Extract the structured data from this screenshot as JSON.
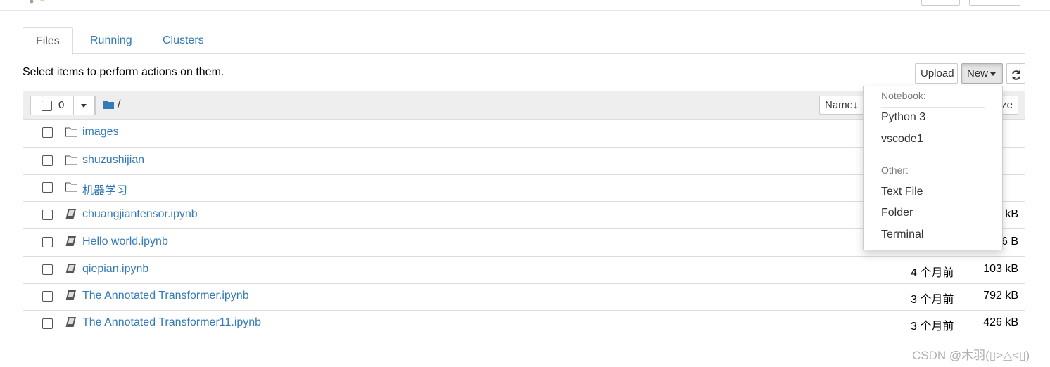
{
  "tabs": [
    {
      "label": "Files"
    },
    {
      "label": "Running"
    },
    {
      "label": "Clusters"
    }
  ],
  "hint": "Select items to perform actions on them.",
  "toolbar": {
    "upload_label": "Upload",
    "new_label": "New"
  },
  "list_header": {
    "selected_count": "0",
    "path": "/",
    "sort_name_label": "Name",
    "size_label": "ze"
  },
  "files": [
    {
      "name": "images",
      "type": "folder",
      "modified": "",
      "size": ""
    },
    {
      "name": "shuzushijian",
      "type": "folder",
      "modified": "",
      "size": ""
    },
    {
      "name": "机器学习",
      "type": "folder",
      "modified": "",
      "size": ""
    },
    {
      "name": "chuangjiantensor.ipynb",
      "type": "notebook",
      "modified": "",
      "size": "kB"
    },
    {
      "name": "Hello world.ipynb",
      "type": "notebook",
      "modified": "",
      "size": "6 B"
    },
    {
      "name": "qiepian.ipynb",
      "type": "notebook",
      "modified": "4 个月前",
      "size": "103 kB"
    },
    {
      "name": "The Annotated Transformer.ipynb",
      "type": "notebook",
      "modified": "3 个月前",
      "size": "792 kB"
    },
    {
      "name": "The Annotated Transformer11.ipynb",
      "type": "notebook",
      "modified": "3 个月前",
      "size": "426 kB"
    }
  ],
  "new_menu": {
    "notebook_header": "Notebook:",
    "notebook_items": [
      "Python 3",
      "vscode1"
    ],
    "other_header": "Other:",
    "other_items": [
      "Text File",
      "Folder",
      "Terminal"
    ]
  },
  "watermark": "CSDN @木羽(▯>△<▯)",
  "colors": {
    "link": "#337ab7",
    "folder_icon": "#337ab7",
    "logo": "#f37726"
  }
}
